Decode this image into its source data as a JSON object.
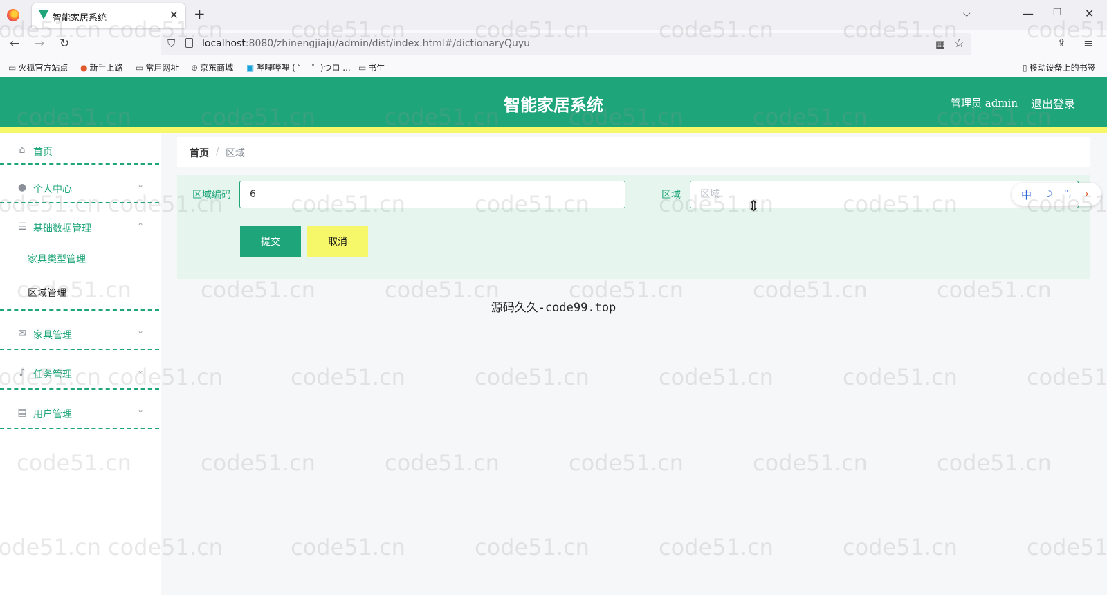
{
  "browser": {
    "tab_title": "智能家居系统",
    "url_host": "localhost",
    "url_rest": ":8080/zhinengjiaju/admin/dist/index.html#/dictionaryQuyu",
    "bookmarks": [
      "火狐官方站点",
      "新手上路",
      "常用网址",
      "京东商城",
      "哔哩哔哩 ( ゜- ゜)つロ ...",
      "书生"
    ],
    "mobile_bookmarks": "移动设备上的书签"
  },
  "header": {
    "title": "智能家居系统",
    "user": "管理员 admin",
    "logout": "退出登录"
  },
  "sidebar": {
    "items": [
      {
        "label": "首页",
        "icon": "home-icon"
      },
      {
        "label": "个人中心",
        "icon": "user-icon"
      },
      {
        "label": "基础数据管理",
        "icon": "sliders-icon"
      },
      {
        "label": "家具管理",
        "icon": "mail-icon"
      },
      {
        "label": "任务管理",
        "icon": "mic-icon"
      },
      {
        "label": "用户管理",
        "icon": "card-icon"
      }
    ],
    "sub_items": [
      "家具类型管理",
      "区域管理"
    ]
  },
  "breadcrumb": {
    "home": "首页",
    "separator": "/",
    "current": "区域"
  },
  "form": {
    "code_label": "区域编码",
    "code_value": "6",
    "area_label": "区域",
    "area_placeholder": "区域",
    "submit": "提交",
    "cancel": "取消"
  },
  "ime": {
    "lang": "中"
  },
  "footer_note": "源码久久-code99.top",
  "watermark": "code51.cn",
  "colors": {
    "primary": "#1fa57a",
    "accent_yellow": "#f7f76a",
    "form_bg": "#e6f6ef"
  }
}
